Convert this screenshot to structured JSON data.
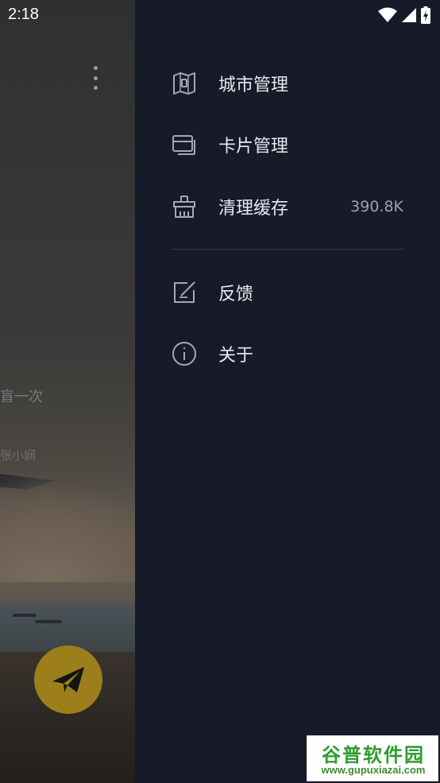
{
  "status_bar": {
    "time": "2:18"
  },
  "background_app": {
    "quote_fragment": "盲一次",
    "author_fragment": "张小娴",
    "fab_icon": "send-icon",
    "fab_color": "#9c7f1b"
  },
  "drawer": {
    "items": [
      {
        "label": "城市管理",
        "icon": "map-icon"
      },
      {
        "label": "卡片管理",
        "icon": "cards-icon"
      },
      {
        "label": "清理缓存",
        "icon": "broom-icon",
        "value": "390.8K"
      },
      {
        "label": "反馈",
        "icon": "feedback-edit-icon"
      },
      {
        "label": "关于",
        "icon": "info-icon"
      }
    ],
    "background": "#171a28"
  },
  "watermark": {
    "title": "谷普软件园",
    "url": "www.gupuxiazai.com"
  }
}
